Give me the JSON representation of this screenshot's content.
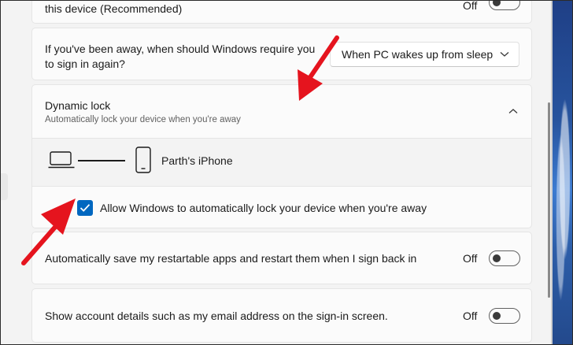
{
  "top_card": {
    "label_tail": "this device (Recommended)",
    "toggle_state": "Off"
  },
  "signin_card": {
    "line1": "If you've been away, when should Windows require you",
    "line2": "to sign in again?",
    "dropdown_value": "When PC wakes up from sleep"
  },
  "dynamic_lock": {
    "title": "Dynamic lock",
    "subtitle": "Automatically lock your device when you're away",
    "paired_device": "Parth's iPhone",
    "checkbox_label": "Allow Windows to automatically lock your device when you're away",
    "checkbox_checked": true
  },
  "restart_apps": {
    "label": "Automatically save my restartable apps and restart them when I sign back in",
    "toggle_state": "Off"
  },
  "account_details": {
    "label": "Show account details such as my email address on the sign-in screen.",
    "toggle_state": "Off"
  },
  "colors": {
    "accent": "#0067c0",
    "annotation_arrow": "#e5141e"
  }
}
